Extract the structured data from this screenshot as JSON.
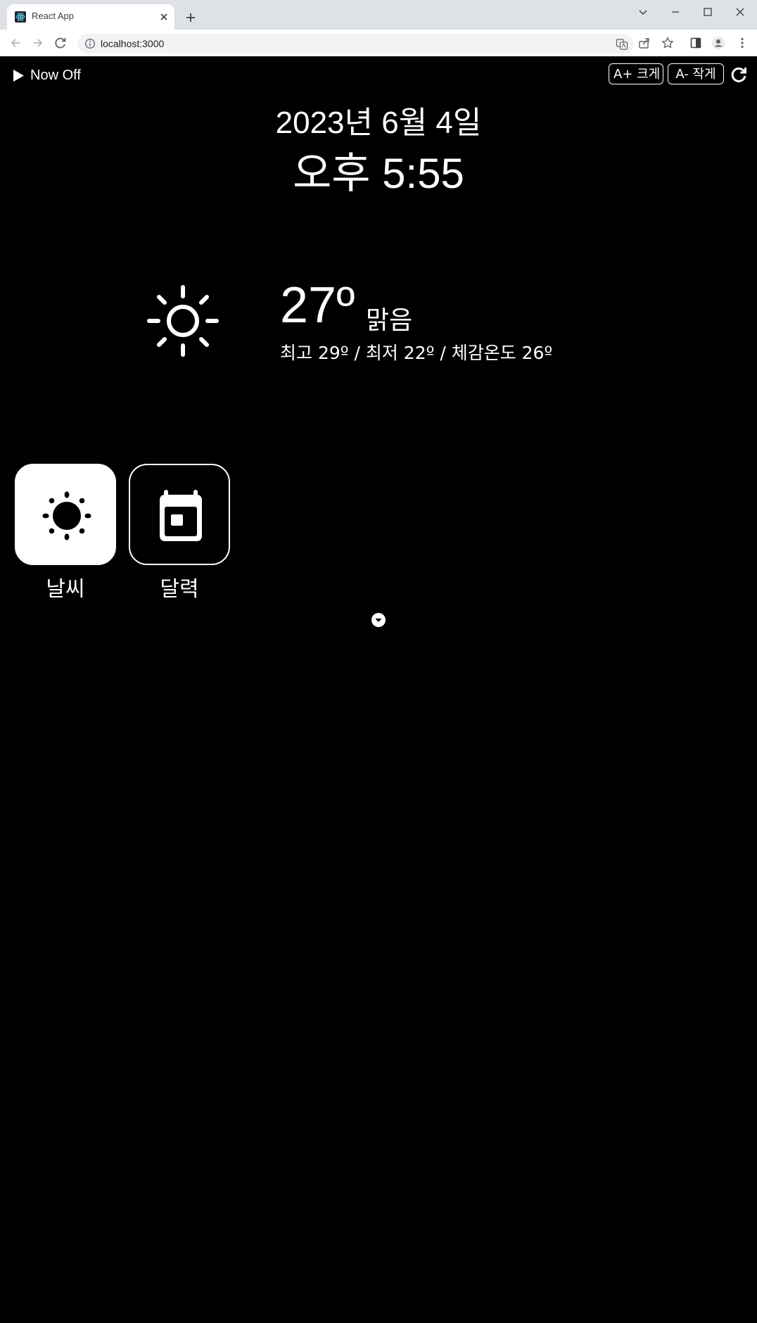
{
  "browser": {
    "tab_title": "React App",
    "url": "localhost:3000"
  },
  "app": {
    "play_label": "Now Off",
    "font_up_label": "A+ 크게",
    "font_down_label": "A- 작게",
    "date": "2023년 6월 4일",
    "time": "오후 5:55",
    "weather": {
      "icon": "sun-icon",
      "temperature": "27º",
      "condition": "맑음",
      "details": "최고 29º / 최저 22º  / 체감온도 26º"
    },
    "tiles": [
      {
        "label": "날씨",
        "icon": "sun-icon",
        "state": "active"
      },
      {
        "label": "달력",
        "icon": "calendar-icon",
        "state": "inactive"
      }
    ]
  },
  "colors": {
    "background": "#000000",
    "foreground": "#ffffff",
    "chrome_tabbar": "#dee1e6"
  }
}
